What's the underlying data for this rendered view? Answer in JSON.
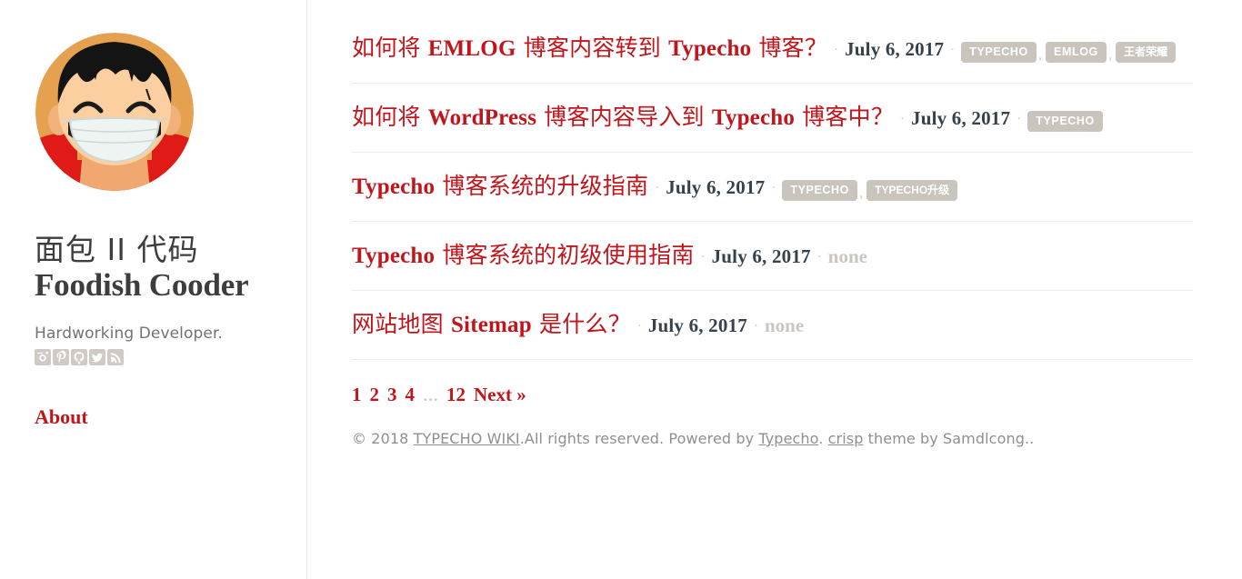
{
  "site": {
    "title_cn": "面包 II 代码",
    "title_en": "Foodish Cooder",
    "tagline": "Hardworking Developer.",
    "about_label": "About",
    "avatar_alt": "anime-character-avatar",
    "accent_color": "#c1151b",
    "tag_color": "#c9c5bd",
    "date_color": "#35414b",
    "muted_color": "#8c8f93"
  },
  "social": [
    {
      "name": "instagram-icon",
      "label": "Instagram"
    },
    {
      "name": "pinterest-icon",
      "label": "Pinterest"
    },
    {
      "name": "github-icon",
      "label": "GitHub"
    },
    {
      "name": "twitter-icon",
      "label": "Twitter"
    },
    {
      "name": "rss-icon",
      "label": "RSS"
    }
  ],
  "posts": [
    {
      "title_parts": [
        {
          "text": "如何将 ",
          "cjk": true
        },
        {
          "text": "EMLOG",
          "cjk": false
        },
        {
          "text": " 博客内容转到 ",
          "cjk": true
        },
        {
          "text": "Typecho",
          "cjk": false
        },
        {
          "text": " 博客？",
          "cjk": true
        }
      ],
      "title_plain": "如何将 EMLOG 博客内容转到 Typecho 博客？",
      "date": "July 6, 2017",
      "tags": [
        "TYPECHO",
        "EMLOG",
        "王者荣耀"
      ]
    },
    {
      "title_parts": [
        {
          "text": "如何将 ",
          "cjk": true
        },
        {
          "text": "WordPress",
          "cjk": false
        },
        {
          "text": " 博客内容导入到 ",
          "cjk": true
        },
        {
          "text": "Typecho",
          "cjk": false
        },
        {
          "text": " 博客中？",
          "cjk": true
        }
      ],
      "title_plain": "如何将 WordPress 博客内容导入到 Typecho 博客中？",
      "date": "July 6, 2017",
      "tags": [
        "TYPECHO"
      ]
    },
    {
      "title_parts": [
        {
          "text": "Typecho",
          "cjk": false
        },
        {
          "text": " 博客系统的升级指南",
          "cjk": true
        }
      ],
      "title_plain": "Typecho 博客系统的升级指南",
      "date": "July 6, 2017",
      "tags": [
        "TYPECHO",
        "TYPECHO升级"
      ]
    },
    {
      "title_parts": [
        {
          "text": "Typecho",
          "cjk": false
        },
        {
          "text": " 博客系统的初级使用指南",
          "cjk": true
        }
      ],
      "title_plain": "Typecho 博客系统的初级使用指南",
      "date": "July 6, 2017",
      "tags": [],
      "no_tags_label": "none"
    },
    {
      "title_parts": [
        {
          "text": "网站地图 ",
          "cjk": true
        },
        {
          "text": "Sitemap",
          "cjk": false
        },
        {
          "text": " 是什么？",
          "cjk": true
        }
      ],
      "title_plain": "网站地图 Sitemap 是什么？",
      "date": "July 6, 2017",
      "tags": [],
      "no_tags_label": "none"
    }
  ],
  "pagination": {
    "pages": [
      "1",
      "2",
      "3",
      "4"
    ],
    "ellipsis": "…",
    "last_page": "12",
    "next_label": "Next »"
  },
  "footer": {
    "copyright_prefix": "© 2018 ",
    "site_link": "TYPECHO WIKI",
    "rights": ".All rights reserved. Powered by ",
    "engine_link": "Typecho",
    "mid": ". ",
    "theme_link": "crisp",
    "suffix": " theme by Samdlcong.."
  }
}
